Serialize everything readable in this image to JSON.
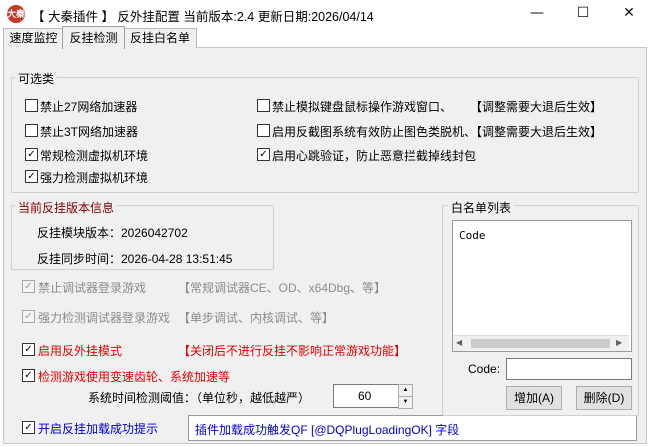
{
  "window": {
    "icon_text": "大秦",
    "title": "【 大秦插件 】 反外挂配置 当前版本:2.4 更新日期:2026/04/14",
    "minimize_glyph": "—",
    "maximize_glyph": "☐",
    "close_glyph": "✕"
  },
  "tabs": [
    {
      "label": "速度监控"
    },
    {
      "label": "反挂检测"
    },
    {
      "label": "反挂白名单"
    }
  ],
  "options_group": {
    "title": "可选类",
    "items": [
      {
        "label": "禁止27网络加速器",
        "checked": false
      },
      {
        "label": "禁止3T网络加速器",
        "checked": false
      },
      {
        "label": "常规检测虚拟机环境",
        "checked": true
      },
      {
        "label": "强力检测虚拟机环境",
        "checked": true
      },
      {
        "label": "禁止模拟键盘鼠标操作游戏窗口、",
        "checked": false,
        "note": "【调整需要大退后生效】"
      },
      {
        "label": "启用反截图系统有效防止图色类脱机、",
        "checked": false,
        "note": "【调整需要大退后生效】"
      },
      {
        "label": "启用心跳验证，防止恶意拦截掉线封包",
        "checked": true
      }
    ]
  },
  "version_group": {
    "title": "当前反挂版本信息",
    "module_version": "反挂模块版本：2026042702",
    "sync_time": "反挂同步时间：2026-04-28 13:51:45"
  },
  "debugger": [
    {
      "label": "禁止调试器登录游戏",
      "note": "【常规调试器CE、OD、x64Dbg、等】",
      "checked": true,
      "enabled": false
    },
    {
      "label": "强力检测调试器登录游戏",
      "note": "【单步调试、内核调试、等】",
      "checked": true,
      "enabled": false
    }
  ],
  "anticheat": {
    "label": "启用反外挂模式",
    "checked": true,
    "note": "【关闭后不进行反挂不影响正常游戏功能】"
  },
  "speed": {
    "label": "检测游戏使用变速齿轮、系统加速等",
    "checked": true,
    "threshold_label": "系统时间检测阈值：（单位秒，越低越严）",
    "threshold_value": "60",
    "spin_up": "▲",
    "spin_down": "▼"
  },
  "load_tip": {
    "label": "开启反挂加载成功提示",
    "checked": true,
    "value": "插件加载成功触发QF [@DQPlugLoadingOK] 字段"
  },
  "whitelist": {
    "title": "白名单列表",
    "column_header": "Code",
    "code_label": "Code:",
    "code_value": "",
    "add_button": "增加(A)",
    "delete_button": "删除(D)",
    "scroll_left": "◀",
    "scroll_right": "▶"
  },
  "colors": {
    "red_text": "#e00000",
    "blue_text": "#0000cc",
    "group_title_darkred": "#800000"
  }
}
